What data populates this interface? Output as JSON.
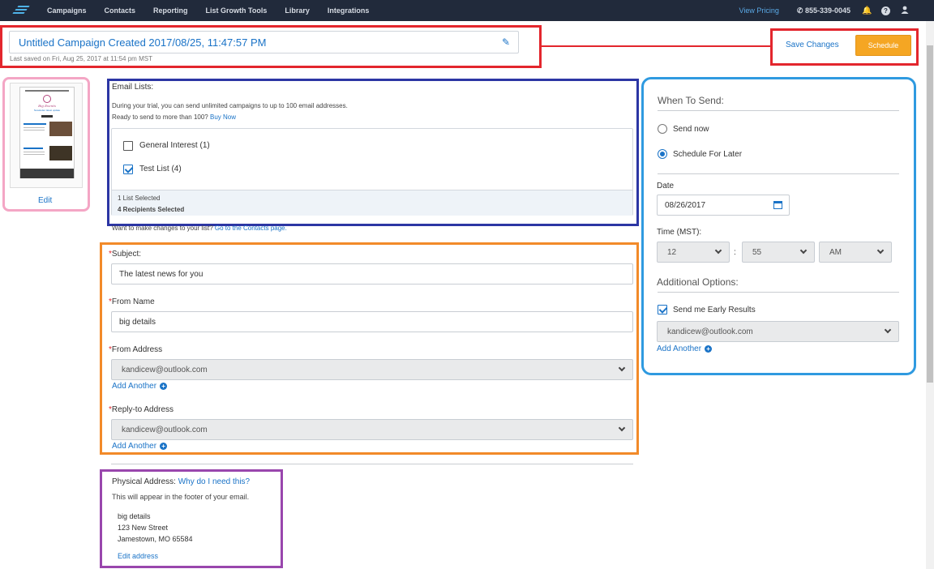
{
  "nav": {
    "items": [
      "Campaigns",
      "Contacts",
      "Reporting",
      "List Growth Tools",
      "Library",
      "Integrations"
    ],
    "view_pricing": "View Pricing",
    "phone": "855-339-0045"
  },
  "header": {
    "campaign_title": "Untitled Campaign Created 2017/08/25, 11:47:57 PM",
    "last_saved": "Last saved on Fri, Aug 25, 2017 at 11:54 pm MST",
    "save_changes": "Save Changes",
    "schedule": "Schedule"
  },
  "preview": {
    "edit": "Edit",
    "thumb_title": "Big Events",
    "thumb_heading": "Newsletter latest update"
  },
  "email_lists": {
    "label": "Email Lists:",
    "trial_note": "During your trial, you can send unlimited campaigns to up to 100 email addresses.",
    "ready_note": "Ready to send to more than 100?",
    "buy_now": "Buy Now",
    "lists": [
      {
        "name": "General Interest (1)",
        "checked": false
      },
      {
        "name": "Test List (4)",
        "checked": true
      }
    ],
    "selected": "1 List Selected",
    "recipients": "4 Recipients Selected",
    "changes_note": "Want to make changes to your list?",
    "contacts_link": "Go to the Contacts page."
  },
  "form": {
    "subject_label": "Subject:",
    "subject_value": "The latest news for you",
    "from_name_label": "From Name",
    "from_name_value": "big details",
    "from_address_label": "From Address",
    "from_address_value": "kandicew@outlook.com",
    "reply_to_label": "Reply-to Address",
    "reply_to_value": "kandicew@outlook.com",
    "add_another": "Add Another",
    "required_mark": "*"
  },
  "physical": {
    "label": "Physical Address:",
    "why": "Why do I need this?",
    "note": "This will appear in the footer of your email.",
    "line1": "big details",
    "line2": "123 New Street",
    "line3": "Jamestown, MO 65584",
    "edit": "Edit address"
  },
  "when": {
    "heading": "When To Send:",
    "send_now": "Send now",
    "schedule_later": "Schedule For Later",
    "selected_option": "Schedule For Later",
    "date_label": "Date",
    "date_value": "08/26/2017",
    "time_label": "Time (MST):",
    "hour": "12",
    "minute": "55",
    "ampm": "AM",
    "colon": ":",
    "additional_heading": "Additional Options:",
    "early_results": "Send me Early Results",
    "early_email": "kandicew@outlook.com",
    "add_another": "Add Another"
  }
}
